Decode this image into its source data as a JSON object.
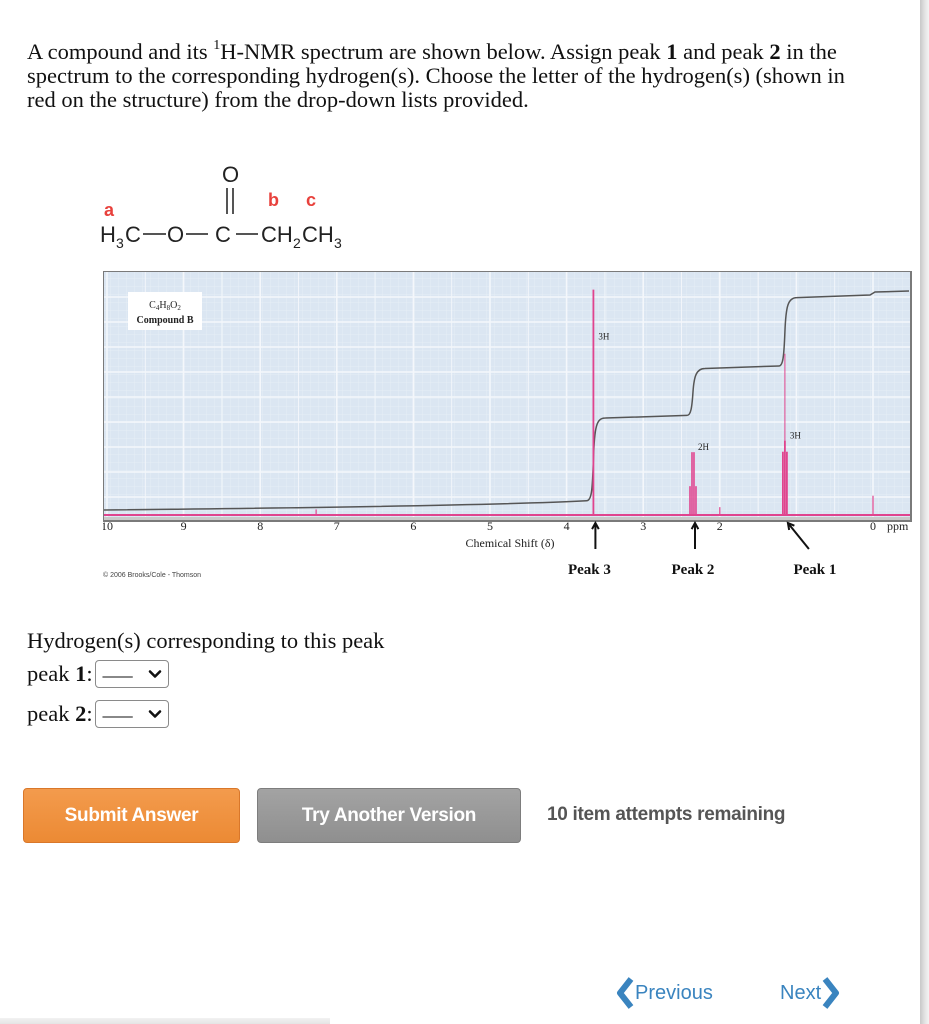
{
  "question": {
    "part1": "A compound and its ",
    "sup": "1",
    "part2": "H-NMR spectrum are shown below. Assign peak ",
    "peak_a": "1",
    "part3": " and peak ",
    "peak_b": "2",
    "part4": " in the spectrum to the corresponding hydrogen(s). Choose the letter of the hydrogen(s) (shown in red on the structure) from the drop-down lists provided."
  },
  "structure": {
    "labels": {
      "a": "a",
      "b": "b",
      "c": "c"
    },
    "label_color": "#e8413c",
    "atoms": {
      "methyl": "H",
      "methyl_sub": "3",
      "methyl_c": "C",
      "o_ether": "O",
      "carbonyl_c": "C",
      "carbonyl_o": "O",
      "ch2": "CH",
      "ch2_sub": "2",
      "ch3": "CH",
      "ch3_sub": "3"
    }
  },
  "chart_data": {
    "type": "line",
    "title": "",
    "box_label_line1": "C4H8O2",
    "box_label_line2": "Compound B",
    "formula_parts": [
      "C",
      "4",
      "H",
      "8",
      "O",
      "2"
    ],
    "xlabel": "Chemical Shift (δ)",
    "x_unit": "ppm",
    "xlim": [
      10,
      0
    ],
    "x_ticks": [
      "10",
      "9",
      "8",
      "7",
      "6",
      "5",
      "4",
      "3",
      "2",
      "",
      "0"
    ],
    "x_tick_values": [
      10,
      9,
      8,
      7,
      6,
      5,
      4,
      3,
      2,
      1,
      0
    ],
    "grid": true,
    "peaks": [
      {
        "shift": 3.65,
        "relative_height": 0.98,
        "integration": "3H",
        "multiplicity": "singlet",
        "marker": "Peak 3"
      },
      {
        "shift": 2.35,
        "relative_height": 0.27,
        "integration": "2H",
        "multiplicity": "quartet",
        "marker": "Peak 2"
      },
      {
        "shift": 1.15,
        "relative_height": 0.32,
        "integration": "3H",
        "multiplicity": "triplet",
        "marker": "Peak 1"
      },
      {
        "shift": 2.0,
        "relative_height": 0.03,
        "integration": "",
        "multiplicity": "impurity",
        "marker": ""
      },
      {
        "shift": 7.27,
        "relative_height": 0.02,
        "integration": "",
        "multiplicity": "impurity",
        "marker": ""
      },
      {
        "shift": 0.0,
        "relative_height": 0.08,
        "integration": "",
        "multiplicity": "TMS",
        "marker": ""
      }
    ],
    "integral_steps": [
      {
        "shift": 3.65,
        "level_after": 0.4
      },
      {
        "shift": 2.35,
        "level_after": 0.63
      },
      {
        "shift": 1.15,
        "level_after": 0.96
      }
    ],
    "peak_color": "#e0448e",
    "integral_color": "#555555",
    "background_color": "#dbe6f2",
    "peak_markers": [
      "Peak 3",
      "Peak 2",
      "Peak 1"
    ],
    "copyright": "© 2006 Brooks/Cole - Thomson"
  },
  "form": {
    "prompt": "Hydrogen(s) corresponding to this peak",
    "rows": [
      {
        "label": "peak ",
        "num": "1",
        "colon": ":",
        "value": "___"
      },
      {
        "label": "peak ",
        "num": "2",
        "colon": ":",
        "value": "___"
      }
    ]
  },
  "actions": {
    "submit": "Submit Answer",
    "try_another": "Try Another Version",
    "attempts": "10 item attempts remaining"
  },
  "nav": {
    "previous": "Previous",
    "next": "Next"
  }
}
